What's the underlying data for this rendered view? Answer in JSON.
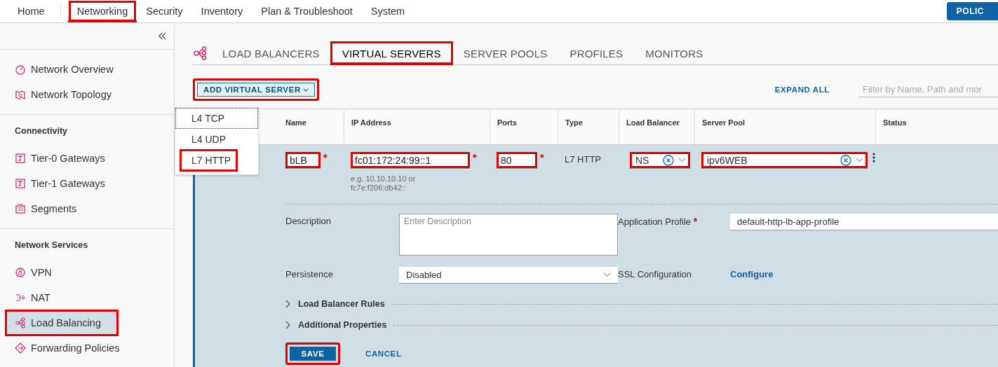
{
  "top_nav": {
    "items": [
      {
        "label": "Home",
        "selected": false,
        "highlighted": false
      },
      {
        "label": "Networking",
        "selected": true,
        "highlighted": true
      },
      {
        "label": "Security",
        "selected": false,
        "highlighted": false
      },
      {
        "label": "Inventory",
        "selected": false,
        "highlighted": false
      },
      {
        "label": "Plan & Troubleshoot",
        "selected": false,
        "highlighted": false
      },
      {
        "label": "System",
        "selected": false,
        "highlighted": false
      }
    ],
    "policy_button": "POLIC"
  },
  "sidebar": {
    "sections": [
      {
        "items": [
          {
            "label": "Network Overview",
            "selected": false,
            "highlighted": false
          },
          {
            "label": "Network Topology",
            "selected": false,
            "highlighted": false
          }
        ]
      },
      {
        "heading": "Connectivity",
        "items": [
          {
            "label": "Tier-0 Gateways",
            "selected": false,
            "highlighted": false
          },
          {
            "label": "Tier-1 Gateways",
            "selected": false,
            "highlighted": false
          },
          {
            "label": "Segments",
            "selected": false,
            "highlighted": false
          }
        ]
      },
      {
        "heading": "Network Services",
        "items": [
          {
            "label": "VPN",
            "selected": false,
            "highlighted": false
          },
          {
            "label": "NAT",
            "selected": false,
            "highlighted": false
          },
          {
            "label": "Load Balancing",
            "selected": true,
            "highlighted": true
          },
          {
            "label": "Forwarding Policies",
            "selected": false,
            "highlighted": false
          }
        ]
      }
    ]
  },
  "tabs": [
    {
      "label": "LOAD BALANCERS",
      "selected": false,
      "highlighted": false
    },
    {
      "label": "VIRTUAL SERVERS",
      "selected": true,
      "highlighted": true
    },
    {
      "label": "SERVER POOLS",
      "selected": false,
      "highlighted": false
    },
    {
      "label": "PROFILES",
      "selected": false,
      "highlighted": false
    },
    {
      "label": "MONITORS",
      "selected": false,
      "highlighted": false
    }
  ],
  "toolbar": {
    "add_button": {
      "label": "ADD VIRTUAL SERVER",
      "highlighted": true
    },
    "dropdown": {
      "options": [
        {
          "label": "L4 TCP",
          "focused": true,
          "highlighted": false
        },
        {
          "label": "L4 UDP",
          "focused": false,
          "highlighted": false
        },
        {
          "label": "L7 HTTP",
          "focused": false,
          "highlighted": true
        }
      ]
    },
    "expand_all": "EXPAND ALL",
    "filter_placeholder": "Filter by Name, Path and mor"
  },
  "table": {
    "columns": [
      "Name",
      "IP Address",
      "Ports",
      "Type",
      "Load Balancer",
      "Server Pool",
      "Status"
    ],
    "edit_row": {
      "required_mark": "*",
      "name": {
        "value": "bLB",
        "required": true,
        "highlighted": true
      },
      "ip_address": {
        "value": "fc01:172:24:99::1",
        "required": true,
        "highlighted": true,
        "hint": "e.g. 10.10.10.10 or fc7e:f206:db42::"
      },
      "ports": {
        "value": "80",
        "required": true,
        "highlighted": true
      },
      "type": "L7 HTTP",
      "load_balancer": {
        "value": "NS",
        "highlighted": true
      },
      "server_pool": {
        "value": "ipv6WEB",
        "highlighted": true
      },
      "description": {
        "label": "Description",
        "placeholder": "Enter Description"
      },
      "application_profile": {
        "label": "Application Profile",
        "value": "default-http-lb-app-profile",
        "required": true
      },
      "persistence": {
        "label": "Persistence",
        "value": "Disabled"
      },
      "ssl_configuration": {
        "label": "SSL Configuration",
        "link": "Configure"
      },
      "sections": [
        {
          "label": "Load Balancer Rules",
          "expanded": false
        },
        {
          "label": "Additional Properties",
          "expanded": false
        }
      ],
      "save_button": {
        "label": "SAVE",
        "highlighted": true
      },
      "cancel_button": "CANCEL"
    }
  }
}
